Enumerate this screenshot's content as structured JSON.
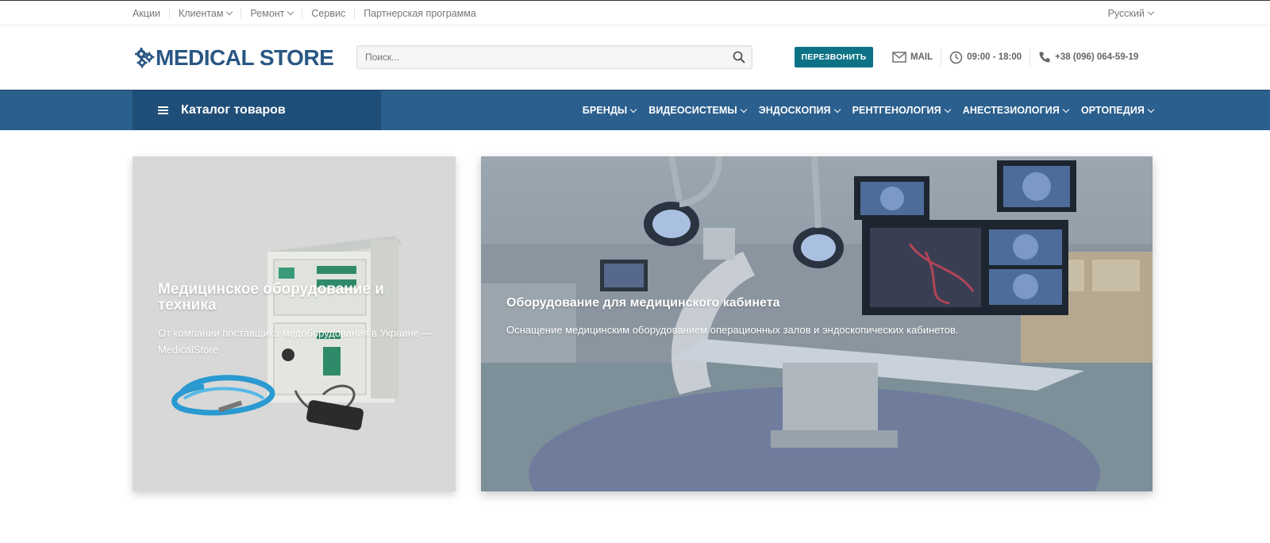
{
  "topbar": {
    "links": [
      {
        "label": "Акции",
        "dropdown": false
      },
      {
        "label": "Клиентам",
        "dropdown": true
      },
      {
        "label": "Ремонт",
        "dropdown": true
      },
      {
        "label": "Сервис",
        "dropdown": false
      },
      {
        "label": "Партнерская программа",
        "dropdown": false
      }
    ],
    "language": "Русский"
  },
  "header": {
    "logo_text": "MEDICAL STORE",
    "search_placeholder": "Поиск...",
    "callback_label": "ПЕРЕЗВОНИТЬ",
    "mail_label": "MAIL",
    "hours": "09:00 - 18:00",
    "phone": "+38 (096) 064-59-19"
  },
  "nav": {
    "catalog_label": "Каталог товаров",
    "items": [
      "БРЕНДЫ",
      "ВИДЕОСИСТЕМЫ",
      "ЭНДОСКОПИЯ",
      "РЕНТГЕНОЛОГИЯ",
      "АНЕСТЕЗИОЛОГИЯ",
      "ОРТОПЕДИЯ"
    ]
  },
  "banners": {
    "left": {
      "title": "Медицинское оборудование и техника",
      "text": "От компании поставщика медоборудования в Украине — MedicalStore"
    },
    "right": {
      "title": "Оборудование для медицинского кабинета",
      "text": "Оснащение медицинским оборудованием операционных залов и эндоскопических кабинетов."
    }
  },
  "colors": {
    "nav_bg": "#2b5f8e",
    "catalog_bg": "#1f4e79",
    "callback_bg": "#0e7286",
    "logo": "#2a5783"
  },
  "icons": [
    "gears-icon",
    "search-icon",
    "mail-icon",
    "clock-icon",
    "phone-icon",
    "menu-icon"
  ]
}
